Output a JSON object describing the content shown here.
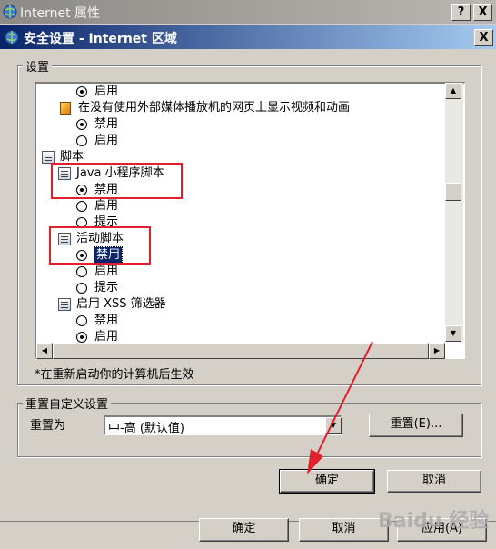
{
  "background_window": {
    "title": "Internet 属性",
    "help_button": "?",
    "close_button": "X",
    "ok_button": "确定",
    "cancel_button": "取消",
    "apply_button": "应用(A)"
  },
  "dialog": {
    "title": "安全设置 - Internet 区域",
    "close_button": "X",
    "settings_group_label": "设置",
    "settings_list": [
      {
        "label": "启用"
      },
      {
        "label": "在没有使用外部媒体播放机的网页上显示视频和动画"
      },
      {
        "label": "禁用"
      },
      {
        "label": "启用"
      },
      {
        "label": "脚本"
      },
      {
        "label": "Java 小程序脚本"
      },
      {
        "label": "禁用"
      },
      {
        "label": "启用"
      },
      {
        "label": "提示"
      },
      {
        "label": "活动脚本"
      },
      {
        "label": "禁用"
      },
      {
        "label": "启用"
      },
      {
        "label": "提示"
      },
      {
        "label": "启用 XSS 筛选器"
      },
      {
        "label": "禁用"
      },
      {
        "label": "启用"
      }
    ],
    "restart_note": "*在重新启动你的计算机后生效",
    "reset_group_label": "重置自定义设置",
    "reset_to_label": "重置为",
    "reset_combo_value": "中-高 (默认值)",
    "reset_button": "重置(E)...",
    "ok_button": "确定",
    "cancel_button": "取消"
  },
  "watermark": "Baidu 经验",
  "colors": {
    "highlight_box": "#e0202c",
    "arrow": "#e0202c",
    "dialog_title_start": "#0a246a",
    "dialog_title_end": "#a6caf0"
  }
}
